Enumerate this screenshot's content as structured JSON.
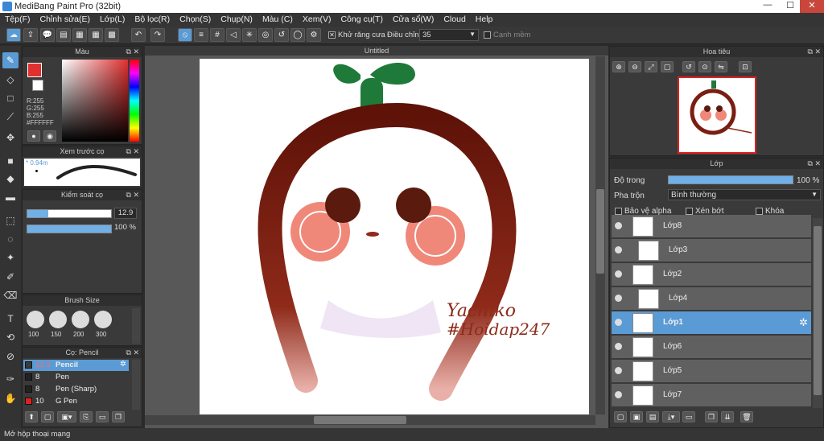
{
  "window": {
    "title": "MediBang Paint Pro (32bit)",
    "minimize": "—",
    "maximize": "☐",
    "close": "✕"
  },
  "menu": [
    "Tệp(F)",
    "Chỉnh sửa(E)",
    "Lớp(L)",
    "Bộ lọc(R)",
    "Chọn(S)",
    "Chụp(N)",
    "Màu (C)",
    "Xem(V)",
    "Công cụ(T)",
    "Cửa sổ(W)",
    "Cloud",
    "Help"
  ],
  "toolbar": {
    "antialias_label": "Khử răng cưa",
    "antialias_checked": "✕",
    "adjust_label": "Điều chỉnh",
    "adjust_value": "35",
    "snap_label": "Cạnh mềm"
  },
  "color_panel": {
    "title": "Màu",
    "r": "R:255",
    "g": "G:255",
    "b": "B:255",
    "hex": "#FFFFFF"
  },
  "brush_preview": {
    "title": "Xem trước cọ",
    "size": "0.94m"
  },
  "brush_control": {
    "title": "Kiểm soát cọ",
    "size_value": "12.9",
    "opacity_value": "100 %"
  },
  "brush_size": {
    "title": "Brush Size",
    "sizes": [
      "100",
      "150",
      "200",
      "300"
    ]
  },
  "brush_list": {
    "title": "Cọ: Pencil",
    "items": [
      {
        "size": "12.9",
        "name": "Pencil",
        "color": "#3a3a3a"
      },
      {
        "size": "8",
        "name": "Pen",
        "color": "#222222"
      },
      {
        "size": "8",
        "name": "Pen (Sharp)",
        "color": "#222222"
      },
      {
        "size": "10",
        "name": "G Pen",
        "color": "#e02020"
      }
    ]
  },
  "canvas": {
    "tab": "Untitled",
    "signature_line1": "Yachiko",
    "signature_line2": "#Hoidap247"
  },
  "navigator": {
    "title": "Hoa tiêu"
  },
  "layers": {
    "title": "Lớp",
    "opacity_label": "Độ trong",
    "opacity_value": "100 %",
    "blend_label": "Pha trộn",
    "blend_value": "Bình thường",
    "protect_alpha": "Bảo vệ alpha",
    "clipping": "Xén bớt",
    "lock": "Khóa",
    "items": [
      "Lớp8",
      "Lớp3",
      "Lớp2",
      "Lớp4",
      "Lớp1",
      "Lớp6",
      "Lớp5",
      "Lớp7"
    ]
  },
  "status": {
    "text": "Mở hộp thoại mạng"
  },
  "colors": {
    "accent": "#5b9bd5",
    "ring": "#7a1e12",
    "leaf": "#1f7a3a",
    "blush": "#f0887a",
    "eye": "#5a1a0e"
  }
}
